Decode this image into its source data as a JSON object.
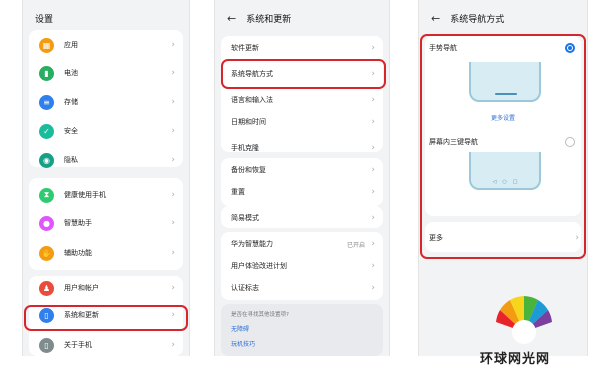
{
  "screen1": {
    "title": "设置",
    "items": [
      {
        "label": "应用",
        "icon": "apps-icon",
        "color": "#f39c12"
      },
      {
        "label": "电池",
        "icon": "battery-icon",
        "color": "#27ae60"
      },
      {
        "label": "存储",
        "icon": "storage-icon",
        "color": "#2f80ed"
      },
      {
        "label": "安全",
        "icon": "shield-icon",
        "color": "#1abc9c"
      },
      {
        "label": "隐私",
        "icon": "privacy-icon",
        "color": "#16a085"
      },
      {
        "label": "健康使用手机",
        "icon": "hourglass-icon",
        "color": "#2ecc71"
      },
      {
        "label": "智慧助手",
        "icon": "assistant-icon",
        "color": "#e056fd"
      },
      {
        "label": "辅助功能",
        "icon": "hand-icon",
        "color": "#f39c12"
      },
      {
        "label": "用户和帐户",
        "icon": "user-icon",
        "color": "#e74c3c"
      },
      {
        "label": "系统和更新",
        "icon": "system-update-icon",
        "color": "#2f80ed"
      },
      {
        "label": "关于手机",
        "icon": "phone-info-icon",
        "color": "#7f8c8d"
      }
    ]
  },
  "screen2": {
    "title": "系统和更新",
    "items": [
      {
        "label": "软件更新"
      },
      {
        "label": "系统导航方式"
      },
      {
        "label": "语言和输入法"
      },
      {
        "label": "日期和时间"
      },
      {
        "label": "手机克隆"
      },
      {
        "label": "备份和恢复"
      },
      {
        "label": "重置"
      },
      {
        "label": "简易模式"
      },
      {
        "label": "华为智慧能力",
        "value": "已开启"
      },
      {
        "label": "用户体验改进计划"
      },
      {
        "label": "认证标志"
      }
    ],
    "suggest": {
      "question": "是否在寻找其他设置项?",
      "links": [
        "无障碍",
        "玩机技巧"
      ]
    }
  },
  "screen3": {
    "title": "系统导航方式",
    "gesture_label": "手势导航",
    "more_settings": "更多设置",
    "three_key_label": "屏幕内三键导航",
    "nav_buttons": [
      "◁",
      "○",
      "□"
    ],
    "more_label": "更多"
  },
  "watermark": {
    "text": "环球网光网"
  },
  "colors": {
    "highlight": "#d7262b",
    "accent": "#1a73e8"
  }
}
